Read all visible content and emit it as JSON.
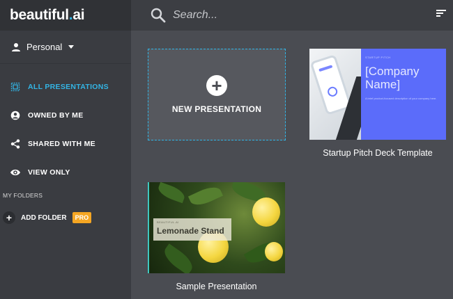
{
  "app": {
    "logo_text": "beautiful",
    "logo_dot": ".",
    "logo_suffix": "ai"
  },
  "workspace": {
    "label": "Personal"
  },
  "nav": [
    {
      "label": "ALL PRESENTATIONS",
      "icon": "presentation-icon",
      "active": true
    },
    {
      "label": "OWNED BY ME",
      "icon": "user-icon",
      "active": false
    },
    {
      "label": "SHARED WITH ME",
      "icon": "share-icon",
      "active": false
    },
    {
      "label": "VIEW ONLY",
      "icon": "eye-icon",
      "active": false
    }
  ],
  "folders": {
    "section_label": "MY FOLDERS",
    "add_label": "ADD FOLDER",
    "badge": "PRO"
  },
  "search": {
    "placeholder": "Search..."
  },
  "new_presentation": {
    "label": "NEW PRESENTATION"
  },
  "presentations": [
    {
      "caption": "Startup Pitch Deck Template",
      "thumb_small": "STARTUP PITCH",
      "thumb_title_line1": "[Company",
      "thumb_title_line2": "Name]",
      "thumb_sub": "A brief product-focused description of your company here."
    },
    {
      "caption": "Sample Presentation",
      "thumb_small": "BEAUTIFUL.AI",
      "thumb_title": "Lemonade Stand"
    }
  ],
  "colors": {
    "accent": "#33b5e5",
    "pro_badge": "#f5a623",
    "pitch_bg": "#5b6cfa"
  }
}
